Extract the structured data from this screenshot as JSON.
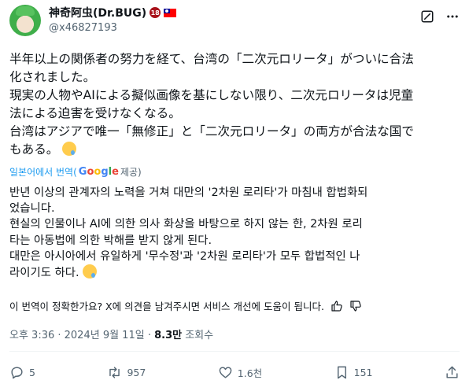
{
  "user": {
    "name": "神奇阿虫(Dr.BUG)",
    "age_badge": "18",
    "handle": "@x46827193"
  },
  "tweet": {
    "lines": [
      "半年以上の関係者の努力を経て、台湾の「二次元ロリータ」がついに合法",
      "化されました。",
      "現実の人物やAIによる擬似画像を基にしない限り、二次元ロリータは児童",
      "法による迫害を受けなくなる。",
      "台湾はアジアで唯一「無修正」と「二次元ロリータ」の両方が合法な国で",
      "もある。"
    ]
  },
  "translation": {
    "prefix": "일본어에서 번역(",
    "google": [
      "G",
      "o",
      "o",
      "g",
      "l",
      "e"
    ],
    "suffix": " 제공)",
    "lines": [
      "반년 이상의 관계자의 노력을 거쳐 대만의 '2차원 로리타'가 마침내 합법화되",
      "었습니다.",
      "현실의 인물이나 AI에 의한 의사 화상을 바탕으로 하지 않는 한, 2차원 로리",
      "타는 아동법에 의한 박해를 받지 않게 된다.",
      "대만은 아시아에서 유일하게 '무수정'과 '2차원 로리타'가 모두 합법적인 나",
      "라이기도 하다."
    ],
    "feedback": "이 번역이 정확한가요? X에 의견을 남겨주시면 서비스 개선에 도움이 됩니다."
  },
  "meta": {
    "time": "오후 3:36 · 2024년 9월 11일 · ",
    "views": "8.3만",
    "views_label": " 조회수"
  },
  "stats": {
    "replies": "5",
    "reposts": "957",
    "likes": "1.6천",
    "bookmarks": "151"
  }
}
